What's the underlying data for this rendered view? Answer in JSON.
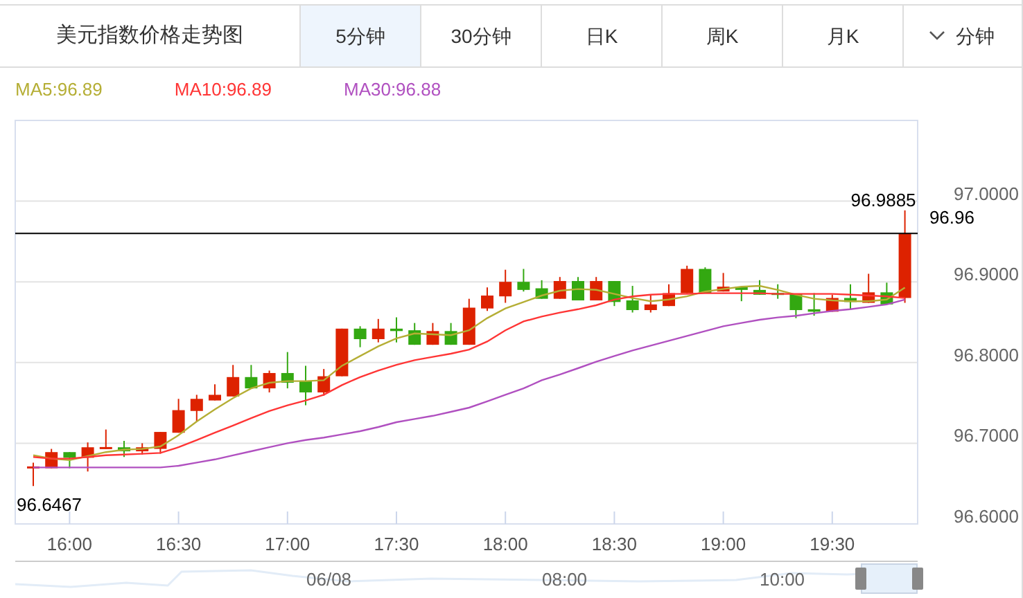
{
  "title": "美元指数价格走势图",
  "tabs": [
    {
      "label": "5分钟",
      "selected": true,
      "kind": "tab"
    },
    {
      "label": "30分钟",
      "selected": false,
      "kind": "tab"
    },
    {
      "label": "日K",
      "selected": false,
      "kind": "tab"
    },
    {
      "label": "周K",
      "selected": false,
      "kind": "tab"
    },
    {
      "label": "月K",
      "selected": false,
      "kind": "tab"
    },
    {
      "label": "分钟",
      "selected": false,
      "kind": "dropdown"
    }
  ],
  "chart": {
    "chart_data": {
      "type": "candlestick",
      "categories": [
        null,
        null,
        "16:00",
        null,
        null,
        null,
        null,
        null,
        "16:30",
        null,
        null,
        null,
        null,
        null,
        "17:00",
        null,
        null,
        null,
        null,
        null,
        "17:30",
        null,
        null,
        null,
        null,
        null,
        "18:00",
        null,
        null,
        null,
        null,
        null,
        "18:30",
        null,
        null,
        null,
        null,
        null,
        "19:00",
        null,
        null,
        null,
        null,
        null,
        "19:30",
        null,
        null,
        null,
        null
      ],
      "grid": true,
      "ylim": [
        96.6,
        97.1
      ],
      "yticks": [
        {
          "value": 96.6,
          "label": "96.6000"
        },
        {
          "value": 96.7,
          "label": "96.7000"
        },
        {
          "value": 96.8,
          "label": "96.8000"
        },
        {
          "value": 96.9,
          "label": "96.9000"
        },
        {
          "value": 97.0,
          "label": "97.0000"
        }
      ],
      "series": [
        {
          "name": "MA5:96.89",
          "type": "line",
          "color": "#b5ae35",
          "values": [
            96.685,
            96.681,
            96.679,
            96.684,
            96.689,
            96.692,
            96.693,
            96.696,
            96.71,
            96.727,
            96.742,
            96.756,
            96.768,
            96.775,
            96.777,
            96.777,
            96.778,
            96.796,
            96.808,
            96.82,
            96.83,
            96.836,
            96.835,
            96.834,
            96.84,
            96.855,
            96.867,
            96.875,
            96.883,
            96.889,
            96.891,
            96.89,
            96.885,
            96.88,
            96.876,
            96.878,
            96.882,
            96.888,
            96.891,
            96.894,
            96.895,
            96.89,
            96.884,
            96.879,
            96.877,
            96.876,
            96.876,
            96.878,
            96.893
          ]
        },
        {
          "name": "MA10:96.89",
          "type": "line",
          "color": "#ff3535",
          "values": [
            96.683,
            96.681,
            96.681,
            96.683,
            96.685,
            96.686,
            96.687,
            96.688,
            96.695,
            96.704,
            96.713,
            96.722,
            96.731,
            96.74,
            96.747,
            96.753,
            96.76,
            96.772,
            96.782,
            96.79,
            96.797,
            96.803,
            96.807,
            96.811,
            96.816,
            96.826,
            96.84,
            96.851,
            96.857,
            96.862,
            96.866,
            96.871,
            96.878,
            96.882,
            96.884,
            96.885,
            96.885,
            96.886,
            96.886,
            96.886,
            96.886,
            96.885,
            96.885,
            96.885,
            96.885,
            96.884,
            96.883,
            96.882,
            96.88
          ]
        },
        {
          "name": "MA30:96.88",
          "type": "line",
          "color": "#b050c0",
          "values": [
            96.67,
            96.67,
            96.67,
            96.67,
            96.67,
            96.67,
            96.67,
            96.67,
            96.672,
            96.676,
            96.68,
            96.685,
            96.69,
            96.695,
            96.7,
            96.704,
            96.707,
            96.711,
            96.715,
            96.72,
            96.726,
            96.73,
            96.734,
            96.739,
            96.744,
            96.752,
            96.76,
            96.768,
            96.778,
            96.785,
            96.793,
            96.801,
            96.808,
            96.815,
            96.821,
            96.827,
            96.833,
            96.839,
            96.845,
            96.849,
            96.853,
            96.856,
            96.858,
            96.861,
            96.864,
            96.866,
            96.869,
            96.872,
            96.878
          ]
        }
      ],
      "ohlc": [
        [
          96.67,
          96.676,
          96.647,
          96.67
        ],
        [
          96.669,
          96.693,
          96.669,
          96.689
        ],
        [
          96.689,
          96.689,
          96.669,
          96.682
        ],
        [
          96.682,
          96.701,
          96.665,
          96.695
        ],
        [
          96.693,
          96.717,
          96.693,
          96.695
        ],
        [
          96.695,
          96.703,
          96.683,
          96.69
        ],
        [
          96.69,
          96.7,
          96.686,
          96.695
        ],
        [
          96.693,
          96.714,
          96.687,
          96.714
        ],
        [
          96.713,
          96.755,
          96.713,
          96.741
        ],
        [
          96.74,
          96.76,
          96.727,
          96.755
        ],
        [
          96.753,
          96.773,
          96.753,
          96.76
        ],
        [
          96.758,
          96.797,
          96.758,
          96.782
        ],
        [
          96.782,
          96.797,
          96.768,
          96.768
        ],
        [
          96.768,
          96.79,
          96.763,
          96.787
        ],
        [
          96.787,
          96.813,
          96.768,
          96.775
        ],
        [
          96.777,
          96.796,
          96.747,
          96.763
        ],
        [
          96.763,
          96.792,
          96.759,
          96.783
        ],
        [
          96.783,
          96.842,
          96.783,
          96.842
        ],
        [
          96.842,
          96.845,
          96.819,
          96.829
        ],
        [
          96.829,
          96.854,
          96.825,
          96.842
        ],
        [
          96.842,
          96.856,
          96.825,
          96.839
        ],
        [
          96.84,
          96.849,
          96.822,
          96.822
        ],
        [
          96.822,
          96.849,
          96.822,
          96.839
        ],
        [
          96.839,
          96.849,
          96.822,
          96.822
        ],
        [
          96.822,
          96.879,
          96.822,
          96.868
        ],
        [
          96.867,
          96.893,
          96.864,
          96.883
        ],
        [
          96.882,
          96.915,
          96.874,
          96.9
        ],
        [
          96.9,
          96.916,
          96.888,
          96.89
        ],
        [
          96.892,
          96.902,
          96.879,
          96.879
        ],
        [
          96.879,
          96.906,
          96.879,
          96.901
        ],
        [
          96.901,
          96.906,
          96.877,
          96.877
        ],
        [
          96.877,
          96.906,
          96.877,
          96.901
        ],
        [
          96.901,
          96.901,
          96.87,
          96.875
        ],
        [
          96.877,
          96.895,
          96.862,
          96.865
        ],
        [
          96.865,
          96.884,
          96.862,
          96.872
        ],
        [
          96.87,
          96.897,
          96.87,
          96.886
        ],
        [
          96.886,
          96.92,
          96.886,
          96.916
        ],
        [
          96.916,
          96.918,
          96.886,
          96.886
        ],
        [
          96.888,
          96.911,
          96.888,
          96.894
        ],
        [
          96.894,
          96.894,
          96.876,
          96.89
        ],
        [
          96.89,
          96.902,
          96.884,
          96.884
        ],
        [
          96.886,
          96.897,
          96.879,
          96.884
        ],
        [
          96.885,
          96.885,
          96.855,
          96.865
        ],
        [
          96.866,
          96.886,
          96.858,
          96.863
        ],
        [
          96.863,
          96.884,
          96.863,
          96.88
        ],
        [
          96.88,
          96.897,
          96.866,
          96.875
        ],
        [
          96.874,
          96.91,
          96.874,
          96.887
        ],
        [
          96.887,
          96.899,
          96.872,
          96.872
        ],
        [
          96.88,
          96.9885,
          96.874,
          96.96
        ]
      ],
      "annotations": [
        "96.6467",
        "96.9885"
      ],
      "ref_lines": [
        {
          "axis": "y",
          "value": 96.96,
          "label": "96.96",
          "color": "#000000"
        }
      ]
    }
  },
  "navigator": {
    "labels": [
      "06/08",
      "08:00",
      "10:00"
    ]
  }
}
